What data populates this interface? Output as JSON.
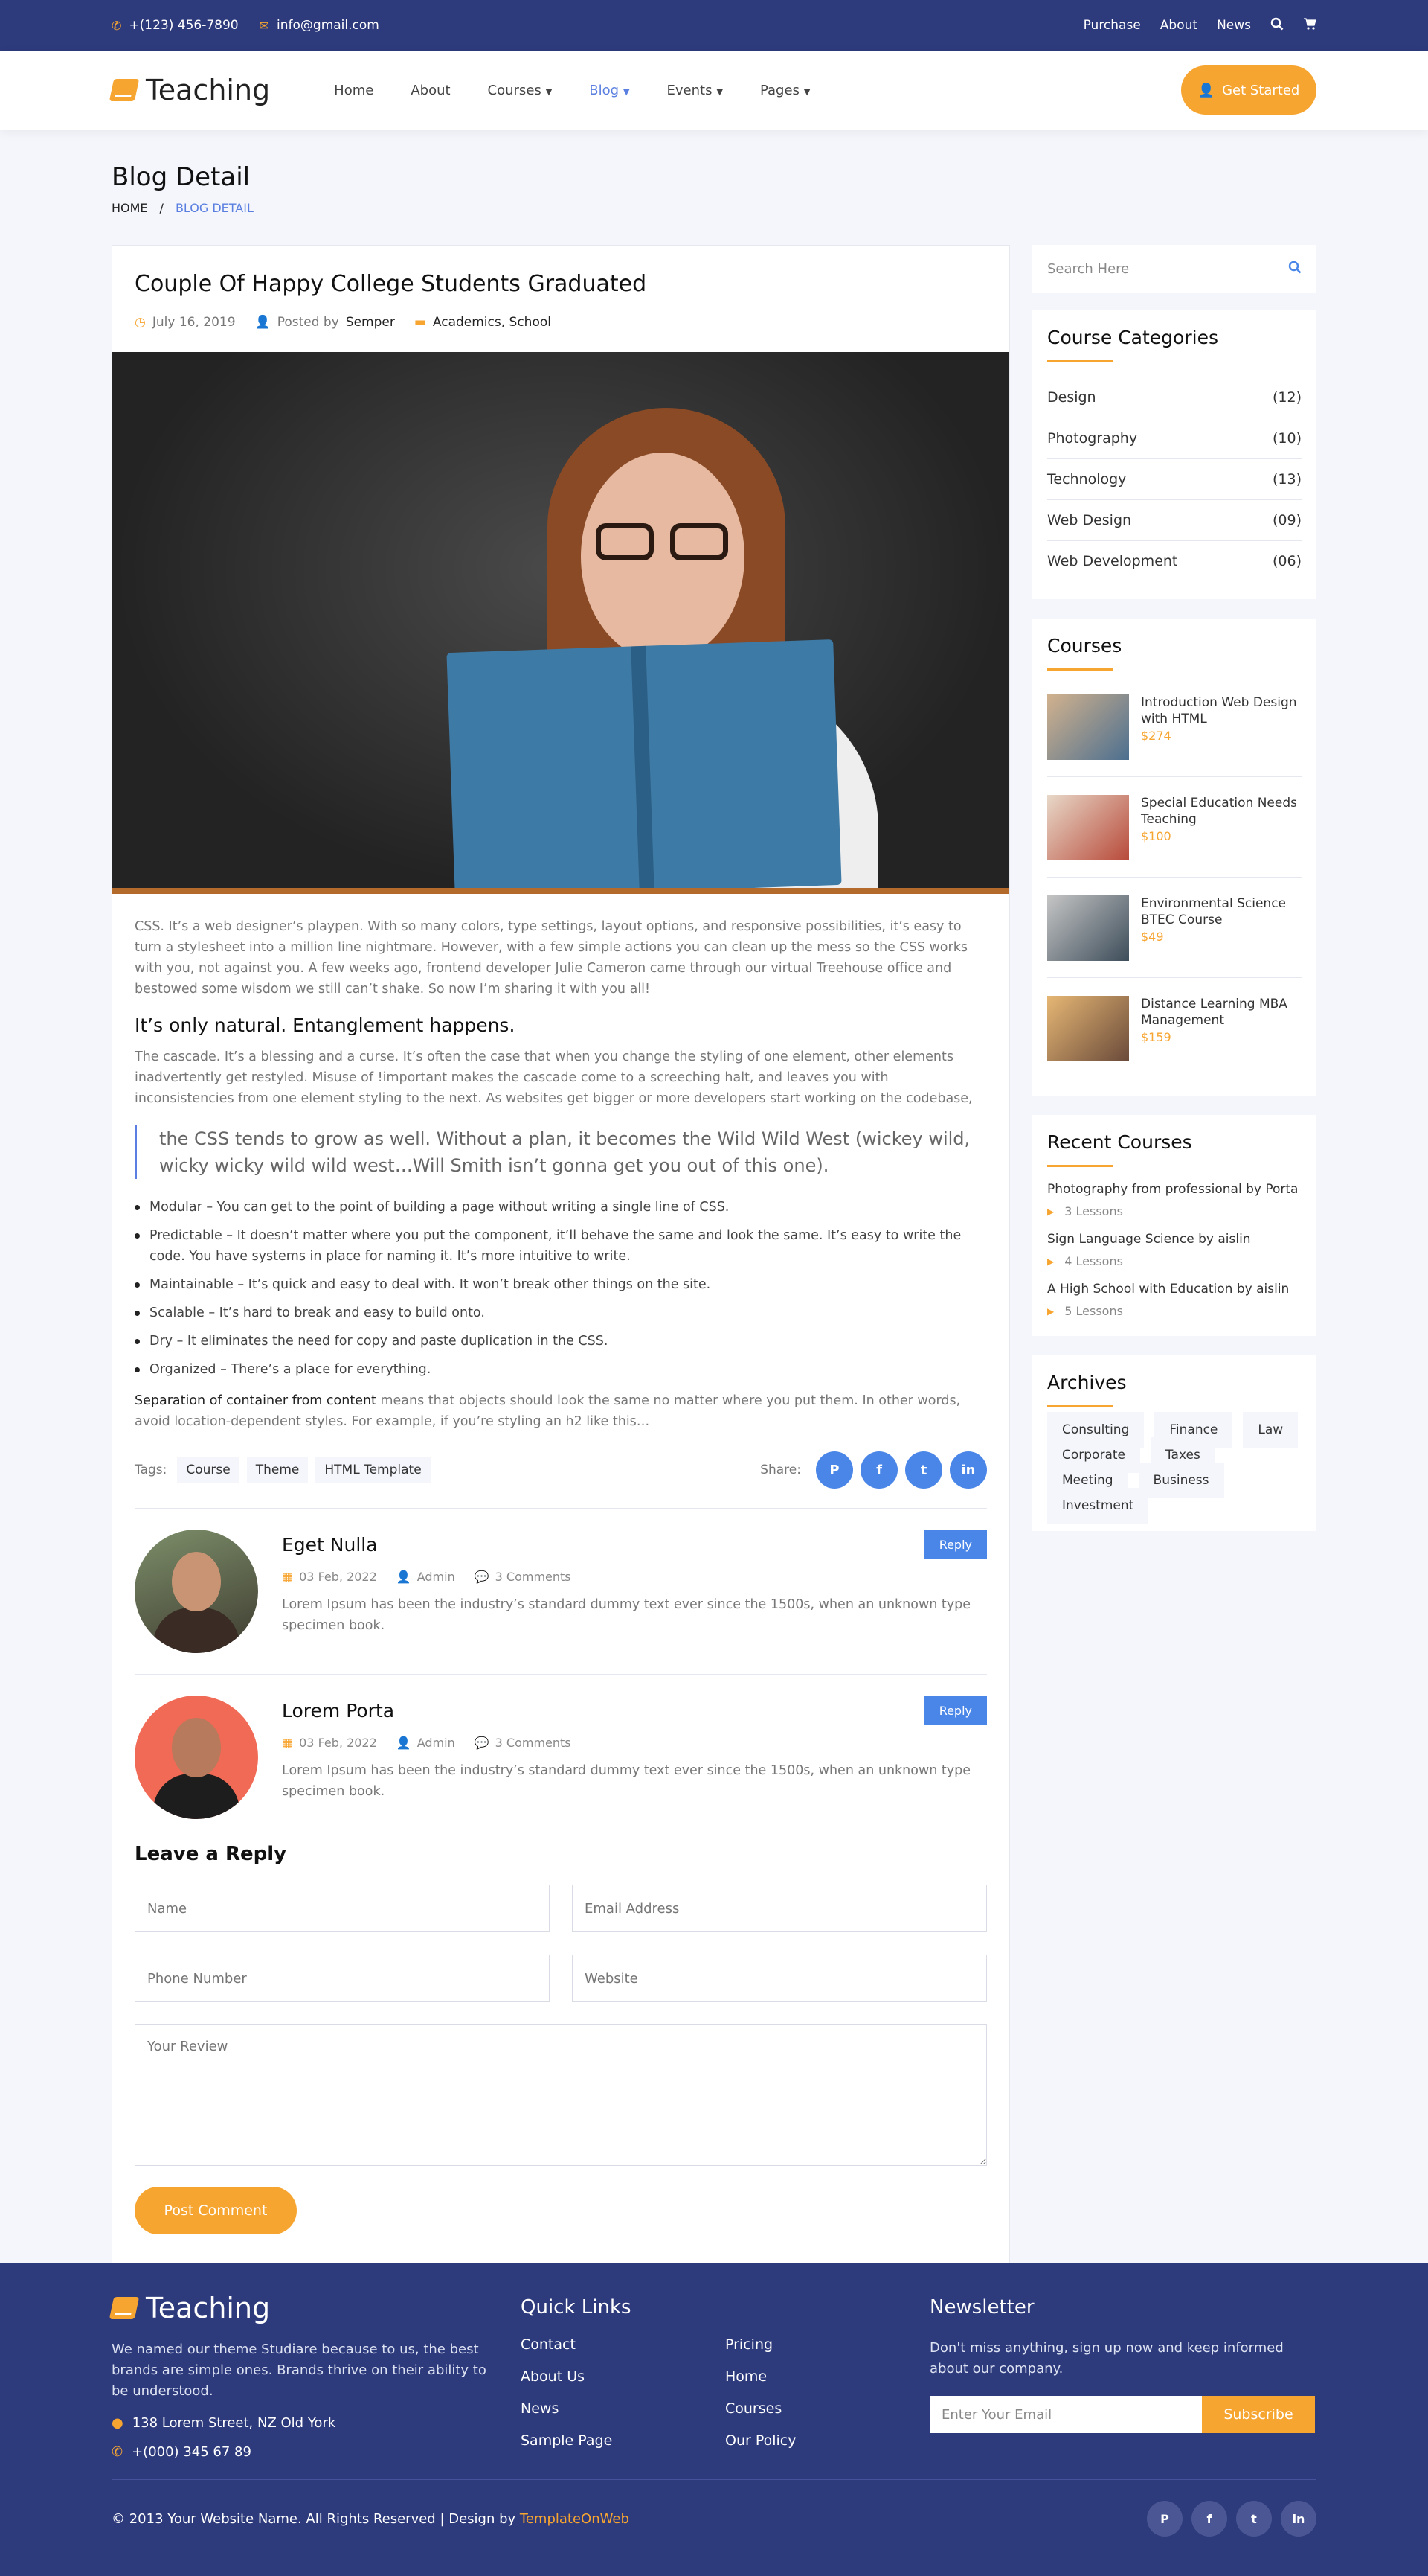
{
  "topbar": {
    "phone": "+(123) 456-7890",
    "email": "info@gmail.com",
    "links": [
      "Purchase",
      "About",
      "News"
    ]
  },
  "nav": {
    "logo": "Teaching",
    "menu": [
      "Home",
      "About",
      "Courses",
      "Blog",
      "Events",
      "Pages"
    ],
    "active": "Blog",
    "cta": "Get Started"
  },
  "page": {
    "title": "Blog Detail",
    "crumb_home": "HOME",
    "crumb_sep": "/",
    "crumb_current": "BLOG DETAIL"
  },
  "article": {
    "title": "Couple Of Happy College Students Graduated",
    "date": "July 16, 2019",
    "posted_by": "Posted by",
    "author": "Semper",
    "categories": "Academics, School",
    "p1": "CSS. It’s a web designer’s playpen. With so many colors, type settings, layout options, and responsive possibilities, it’s easy to turn a stylesheet into a million line nightmare. However, with a few simple actions you can clean up the mess so the CSS works with you, not against you. A few weeks ago, frontend developer Julie Cameron came through our virtual Treehouse office and bestowed some wisdom we still can’t shake. So now I’m sharing it with you all!",
    "subhead": "It’s only natural. Entanglement happens.",
    "p2": "The cascade. It’s a blessing and a curse. It’s often the case that when you change the styling of one element, other elements inadvertently get restyled. Misuse of !important makes the cascade come to a screeching halt, and leaves you with inconsistencies from one element styling to the next. As websites get bigger or more developers start working on the codebase,",
    "quote": "the CSS tends to grow as well. Without a plan, it becomes the Wild Wild West (wickey wild, wicky wicky wild wild west…Will Smith isn’t gonna get you out of this one).",
    "list": [
      "Modular – You can get to the point of building a page without writing a single line of CSS.",
      "Predictable – It doesn’t matter where you put the component, it’ll behave the same and look the same. It’s easy to write the code. You have systems in place for naming it. It’s more intuitive to write.",
      "Maintainable – It’s quick and easy to deal with. It won’t break other things on the site.",
      "Scalable – It’s hard to break and easy to build onto.",
      "Dry – It eliminates the need for copy and paste duplication in the CSS.",
      "Organized – There’s a place for everything."
    ],
    "sep_bold": "Separation of container from content",
    "sep_rest": " means that objects should look the same no matter where you put them. In other words, avoid location-dependent styles. For example, if you’re styling an h2 like this…",
    "tags_label": "Tags:",
    "tags": [
      "Course",
      "Theme",
      "HTML Template"
    ],
    "share_label": "Share:"
  },
  "comments": [
    {
      "name": "Eget Nulla",
      "date": "03 Feb, 2022",
      "author": "Admin",
      "count": "3 Comments",
      "text": "Lorem Ipsum has been the industry’s standard dummy text ever since the 1500s, when an unknown type specimen book.",
      "reply": "Reply"
    },
    {
      "name": "Lorem Porta",
      "date": "03 Feb, 2022",
      "author": "Admin",
      "count": "3 Comments",
      "text": "Lorem Ipsum has been the industry’s standard dummy text ever since the 1500s, when an unknown type specimen book.",
      "reply": "Reply"
    }
  ],
  "form": {
    "title": "Leave a Reply",
    "name": "Name",
    "email": "Email Address",
    "phone": "Phone Number",
    "website": "Website",
    "review": "Your Review",
    "submit": "Post Comment"
  },
  "sidebar": {
    "search_placeholder": "Search Here",
    "categories_title": "Course Categories",
    "categories": [
      {
        "name": "Design",
        "count": "(12)"
      },
      {
        "name": "Photography",
        "count": "(10)"
      },
      {
        "name": "Technology",
        "count": "(13)"
      },
      {
        "name": "Web Design",
        "count": "(09)"
      },
      {
        "name": "Web Development",
        "count": "(06)"
      }
    ],
    "courses_title": "Courses",
    "courses": [
      {
        "title": "Introduction Web Design with HTML",
        "price": "$274"
      },
      {
        "title": "Special Education Needs Teaching",
        "price": "$100"
      },
      {
        "title": "Environmental Science BTEC Course",
        "price": "$49"
      },
      {
        "title": "Distance Learning MBA Management",
        "price": "$159"
      }
    ],
    "recent_title": "Recent Courses",
    "recent": [
      {
        "title": "Photography from professional by Porta",
        "lessons": "3 Lessons"
      },
      {
        "title": "Sign Language Science by aislin",
        "lessons": "4 Lessons"
      },
      {
        "title": "A High School with Education by aislin",
        "lessons": "5 Lessons"
      }
    ],
    "archives_title": "Archives",
    "archives": [
      "Consulting",
      "Finance",
      "Law",
      "Corporate",
      "Taxes",
      "Meeting",
      "Business",
      "Investment"
    ]
  },
  "footer": {
    "logo": "Teaching",
    "about": "We named our theme Studiare because to us, the best brands are simple ones. Brands thrive on their ability to be understood.",
    "address": "138 Lorem Street, NZ Old York",
    "phone": "+(000) 345 67 89",
    "quick_title": "Quick Links",
    "quick_col1": [
      "Contact",
      "About Us",
      "News",
      "Sample Page"
    ],
    "quick_col2": [
      "Pricing",
      "Home",
      "Courses",
      "Our Policy"
    ],
    "news_title": "Newsletter",
    "news_text": "Don't miss anything, sign up now and keep informed about our company.",
    "email_placeholder": "Enter Your Email",
    "subscribe": "Subscribe",
    "copyright": "© 2013 Your Website Name. All Rights Reserved | Design by ",
    "designer": "TemplateOnWeb"
  },
  "colors": {
    "primary": "#2d3a7b",
    "accent": "#f7a531",
    "link": "#4a86e8"
  },
  "icons": [
    "phone-icon",
    "envelope-icon",
    "search-icon",
    "cart-icon",
    "user-icon",
    "clock-icon",
    "folder-icon",
    "calendar-icon",
    "comments-icon",
    "pinterest-icon",
    "facebook-icon",
    "twitter-icon",
    "linkedin-icon",
    "map-marker-icon",
    "caret-right-icon"
  ]
}
